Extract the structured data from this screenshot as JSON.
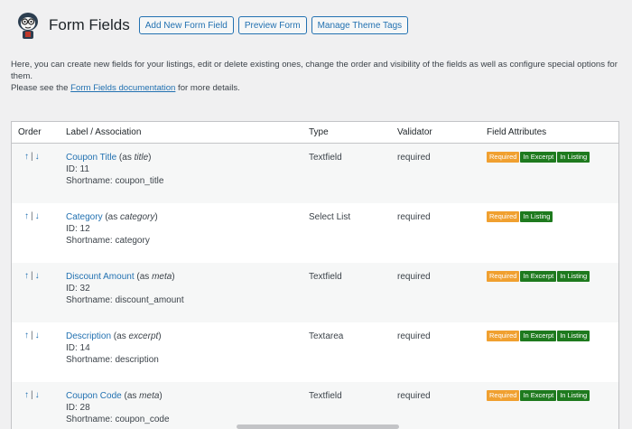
{
  "header": {
    "title": "Form Fields",
    "buttons": [
      "Add New Form Field",
      "Preview Form",
      "Manage Theme Tags"
    ]
  },
  "intro": {
    "line1": "Here, you can create new fields for your listings, edit or delete existing ones, change the order and visibility of the fields as well as configure special options for them.",
    "line2_prefix": "Please see the ",
    "line2_link": "Form Fields documentation",
    "line2_suffix": " for more details."
  },
  "table": {
    "headers": {
      "order": "Order",
      "label": "Label / Association",
      "type": "Type",
      "validator": "Validator",
      "attributes": "Field Attributes"
    },
    "order_up": "↑",
    "order_sep": "|",
    "order_down": "↓",
    "badge_labels": {
      "required": "Required",
      "excerpt": "In Excerpt",
      "listing": "In Listing"
    },
    "rows": [
      {
        "name": "Coupon Title",
        "as_prefix": " (as ",
        "assoc": "title",
        "as_suffix": ")",
        "id": "ID: 11",
        "shortname": "Shortname: coupon_title",
        "type": "Textfield",
        "validator": "required",
        "badges": [
          "required",
          "excerpt",
          "listing"
        ]
      },
      {
        "name": "Category",
        "as_prefix": " (as ",
        "assoc": "category",
        "as_suffix": ")",
        "id": "ID: 12",
        "shortname": "Shortname: category",
        "type": "Select List",
        "validator": "required",
        "badges": [
          "required",
          "listing"
        ]
      },
      {
        "name": "Discount Amount",
        "as_prefix": " (as ",
        "assoc": "meta",
        "as_suffix": ")",
        "id": "ID: 32",
        "shortname": "Shortname: discount_amount",
        "type": "Textfield",
        "validator": "required",
        "badges": [
          "required",
          "excerpt",
          "listing"
        ]
      },
      {
        "name": "Description",
        "as_prefix": " (as ",
        "assoc": "excerpt",
        "as_suffix": ")",
        "id": "ID: 14",
        "shortname": "Shortname: description",
        "type": "Textarea",
        "validator": "required",
        "badges": [
          "required",
          "excerpt",
          "listing"
        ]
      },
      {
        "name": "Coupon Code",
        "as_prefix": " (as ",
        "assoc": "meta",
        "as_suffix": ")",
        "id": "ID: 28",
        "shortname": "Shortname: coupon_code",
        "type": "Textfield",
        "validator": "required",
        "badges": [
          "required",
          "excerpt",
          "listing"
        ]
      }
    ]
  },
  "colors": {
    "link": "#2271b1",
    "required": "#f0a030",
    "excerpt": "#1e7a1e",
    "listing": "#1e7a1e"
  }
}
